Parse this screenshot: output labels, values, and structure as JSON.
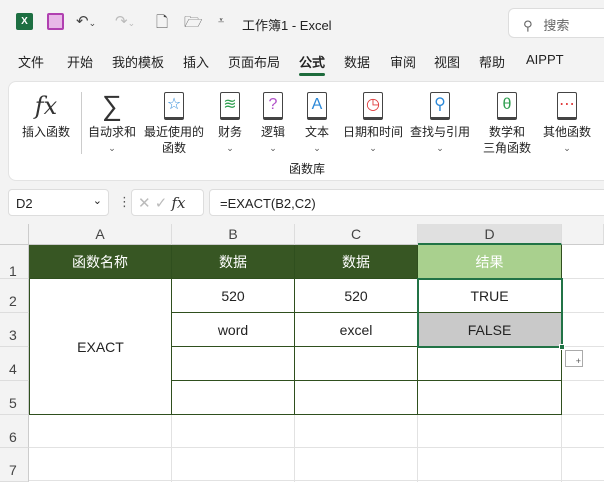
{
  "titlebar": {
    "title": "工作簿1  -  Excel",
    "search_placeholder": "搜索"
  },
  "tabs": [
    "文件",
    "开始",
    "我的模板",
    "插入",
    "页面布局",
    "公式",
    "数据",
    "审阅",
    "视图",
    "帮助",
    "AIPPT"
  ],
  "active_tab": "公式",
  "ribbon": {
    "group_label": "函数库",
    "buttons": [
      {
        "label": "插入函数",
        "icon": "fx-icon"
      },
      {
        "label": "自动求和",
        "icon": "sigma-icon"
      },
      {
        "label": "最近使用的\n函数",
        "icon": "star-icon"
      },
      {
        "label": "财务",
        "icon": "database-icon"
      },
      {
        "label": "逻辑",
        "icon": "question-icon"
      },
      {
        "label": "文本",
        "icon": "text-a-icon"
      },
      {
        "label": "日期和时间",
        "icon": "clock-icon"
      },
      {
        "label": "查找与引用",
        "icon": "magnifier-icon"
      },
      {
        "label": "数学和\n三角函数",
        "icon": "theta-icon"
      },
      {
        "label": "其他函数",
        "icon": "more-icon"
      }
    ]
  },
  "formula_bar": {
    "name_box": "D2",
    "formula": "=EXACT(B2,C2)"
  },
  "sheet": {
    "columns": [
      "A",
      "B",
      "C",
      "D"
    ],
    "rows": [
      "1",
      "2",
      "3",
      "4",
      "5",
      "6",
      "7"
    ],
    "header": [
      "函数名称",
      "数据",
      "数据",
      "结果"
    ],
    "merged_a": "EXACT",
    "data": [
      [
        "520",
        "520",
        "TRUE"
      ],
      [
        "word",
        "excel",
        "FALSE"
      ]
    ]
  },
  "colors": {
    "header_bg": "#375623",
    "result_header_bg": "#a9d08e",
    "selection": "#217346",
    "false_bg": "#c9c9c9"
  }
}
